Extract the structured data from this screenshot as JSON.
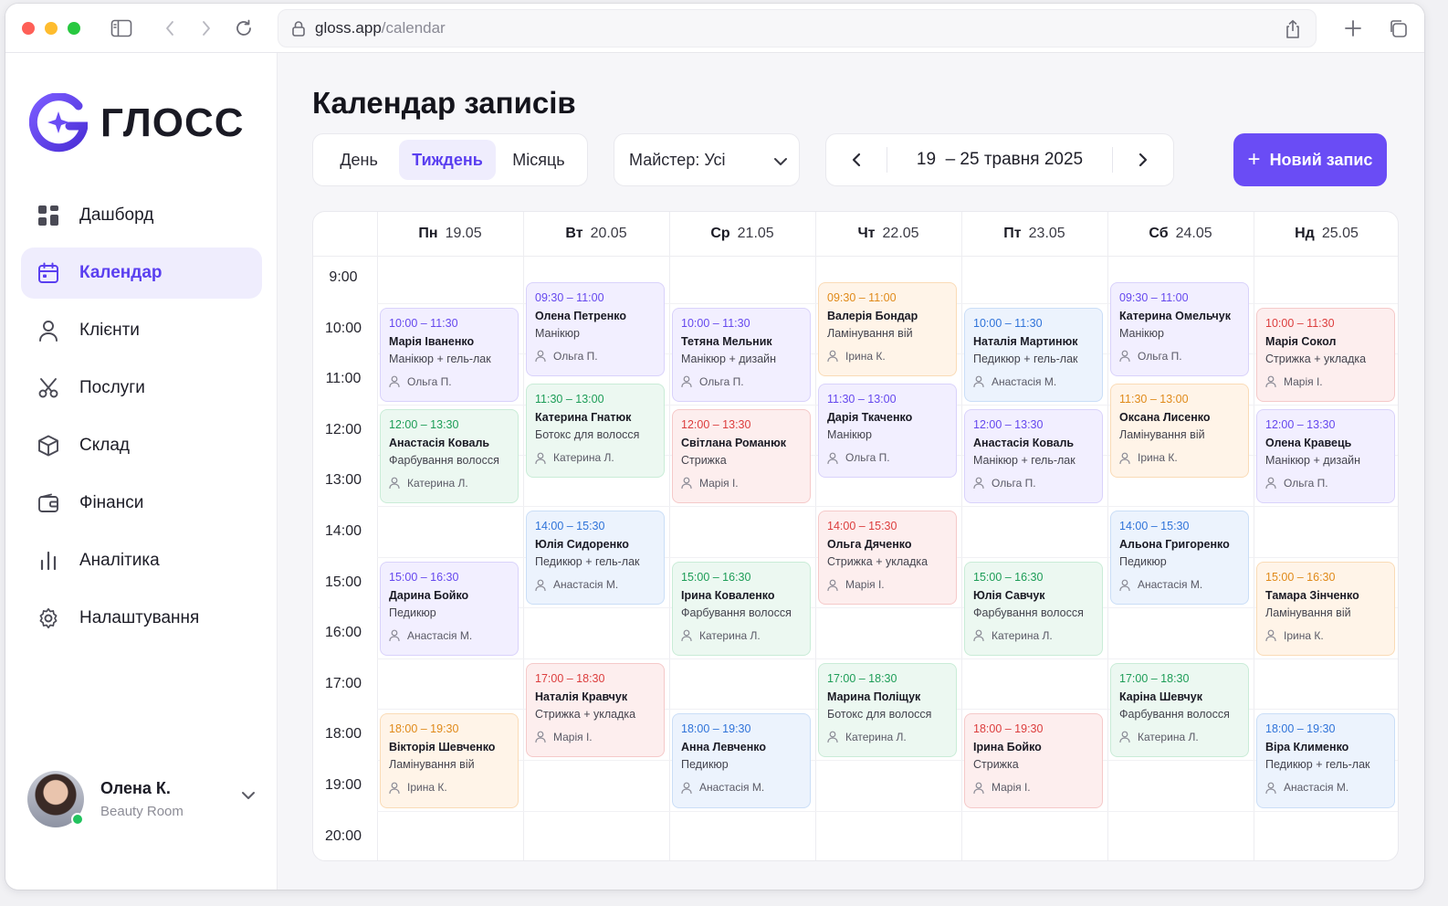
{
  "browser": {
    "url_host": "gloss.app",
    "url_path": "/calendar"
  },
  "brand": {
    "name": "ГЛОСС",
    "accent": "#6a4cf5"
  },
  "nav": [
    {
      "key": "dashboard",
      "label": "Дашборд",
      "icon": "grid-icon"
    },
    {
      "key": "calendar",
      "label": "Календар",
      "icon": "calendar-icon",
      "active": true
    },
    {
      "key": "clients",
      "label": "Клієнти",
      "icon": "user-icon"
    },
    {
      "key": "services",
      "label": "Послуги",
      "icon": "scissors-icon"
    },
    {
      "key": "stock",
      "label": "Склад",
      "icon": "box-icon"
    },
    {
      "key": "finance",
      "label": "Фінанси",
      "icon": "wallet-icon"
    },
    {
      "key": "analytics",
      "label": "Аналітика",
      "icon": "bar-chart-icon"
    },
    {
      "key": "settings",
      "label": "Налаштування",
      "icon": "gear-icon"
    }
  ],
  "user": {
    "name": "Олена К.",
    "subtitle": "Beauty Room"
  },
  "header": {
    "title": "Календар записів",
    "views": [
      {
        "label": "День"
      },
      {
        "label": "Тиждень",
        "active": true
      },
      {
        "label": "Місяць"
      }
    ],
    "master_filter": "Майстер: Усі",
    "date_range": "19  – 25 травня 2025",
    "new_button": "Новий запис"
  },
  "calendar": {
    "days": [
      {
        "dn": "Пн",
        "date": "19.05"
      },
      {
        "dn": "Вт",
        "date": "20.05"
      },
      {
        "dn": "Ср",
        "date": "21.05"
      },
      {
        "dn": "Чт",
        "date": "22.05"
      },
      {
        "dn": "Пт",
        "date": "23.05"
      },
      {
        "dn": "Сб",
        "date": "24.05"
      },
      {
        "dn": "Нд",
        "date": "25.05"
      }
    ],
    "hours": [
      "9:00",
      "10:00",
      "11:00",
      "12:00",
      "13:00",
      "14:00",
      "15:00",
      "16:00",
      "17:00",
      "18:00",
      "19:00",
      "20:00"
    ],
    "appointments": [
      {
        "day": 0,
        "start": 10.0,
        "time": "10:00 – 11:30",
        "client": "Марія Іваненко",
        "service": "Манікюр + гель-лак",
        "master": "Ольга П.",
        "color": "purple"
      },
      {
        "day": 0,
        "start": 12.0,
        "time": "12:00 – 13:30",
        "client": "Анастасія Коваль",
        "service": "Фарбування волосся",
        "master": "Катерина Л.",
        "color": "green"
      },
      {
        "day": 0,
        "start": 15.0,
        "time": "15:00 – 16:30",
        "client": "Дарина Бойко",
        "service": "Педикюр",
        "master": "Анастасія М.",
        "color": "purple"
      },
      {
        "day": 0,
        "start": 18.0,
        "time": "18:00 – 19:30",
        "client": "Вікторія Шевченко",
        "service": "Ламінування вій",
        "master": "Ірина К.",
        "color": "orange"
      },
      {
        "day": 1,
        "start": 9.5,
        "time": "09:30 – 11:00",
        "client": "Олена Петренко",
        "service": "Манікюр",
        "master": "Ольга П.",
        "color": "purple"
      },
      {
        "day": 1,
        "start": 11.5,
        "time": "11:30 – 13:00",
        "client": "Катерина Гнатюк",
        "service": "Ботокс для волосся",
        "master": "Катерина Л.",
        "color": "green"
      },
      {
        "day": 1,
        "start": 14.0,
        "time": "14:00 – 15:30",
        "client": "Юлія Сидоренко",
        "service": "Педикюр + гель-лак",
        "master": "Анастасія М.",
        "color": "blue"
      },
      {
        "day": 1,
        "start": 17.0,
        "time": "17:00 – 18:30",
        "client": "Наталія Кравчук",
        "service": "Стрижка + укладка",
        "master": "Марія І.",
        "color": "red"
      },
      {
        "day": 2,
        "start": 10.0,
        "time": "10:00 – 11:30",
        "client": "Тетяна Мельник",
        "service": "Манікюр + дизайн",
        "master": "Ольга П.",
        "color": "purple"
      },
      {
        "day": 2,
        "start": 12.0,
        "time": "12:00 – 13:30",
        "client": "Світлана Романюк",
        "service": "Стрижка",
        "master": "Марія І.",
        "color": "red"
      },
      {
        "day": 2,
        "start": 15.0,
        "time": "15:00 – 16:30",
        "client": "Ірина Коваленко",
        "service": "Фарбування волосся",
        "master": "Катерина Л.",
        "color": "green"
      },
      {
        "day": 2,
        "start": 18.0,
        "time": "18:00 – 19:30",
        "client": "Анна Левченко",
        "service": "Педикюр",
        "master": "Анастасія М.",
        "color": "blue"
      },
      {
        "day": 3,
        "start": 9.5,
        "time": "09:30 – 11:00",
        "client": "Валерія Бондар",
        "service": "Ламінування вій",
        "master": "Ірина К.",
        "color": "orange"
      },
      {
        "day": 3,
        "start": 11.5,
        "time": "11:30 – 13:00",
        "client": "Дарія Ткаченко",
        "service": "Манікюр",
        "master": "Ольга П.",
        "color": "purple"
      },
      {
        "day": 3,
        "start": 14.0,
        "time": "14:00 – 15:30",
        "client": "Ольга Дяченко",
        "service": "Стрижка + укладка",
        "master": "Марія І.",
        "color": "red"
      },
      {
        "day": 3,
        "start": 17.0,
        "time": "17:00 – 18:30",
        "client": "Марина Поліщук",
        "service": "Ботокс для волосся",
        "master": "Катерина Л.",
        "color": "green"
      },
      {
        "day": 4,
        "start": 10.0,
        "time": "10:00 – 11:30",
        "client": "Наталія Мартинюк",
        "service": "Педикюр + гель-лак",
        "master": "Анастасія М.",
        "color": "blue"
      },
      {
        "day": 4,
        "start": 12.0,
        "time": "12:00 – 13:30",
        "client": "Анастасія Коваль",
        "service": "Манікюр + гель-лак",
        "master": "Ольга П.",
        "color": "purple"
      },
      {
        "day": 4,
        "start": 15.0,
        "time": "15:00 – 16:30",
        "client": "Юлія Савчук",
        "service": "Фарбування волосся",
        "master": "Катерина Л.",
        "color": "green"
      },
      {
        "day": 4,
        "start": 18.0,
        "time": "18:00 – 19:30",
        "client": "Ірина Бойко",
        "service": "Стрижка",
        "master": "Марія І.",
        "color": "red"
      },
      {
        "day": 5,
        "start": 9.5,
        "time": "09:30 – 11:00",
        "client": "Катерина Омельчук",
        "service": "Манікюр",
        "master": "Ольга П.",
        "color": "purple"
      },
      {
        "day": 5,
        "start": 11.5,
        "time": "11:30 – 13:00",
        "client": "Оксана Лисенко",
        "service": "Ламінування вій",
        "master": "Ірина К.",
        "color": "orange"
      },
      {
        "day": 5,
        "start": 14.0,
        "time": "14:00 – 15:30",
        "client": "Альона Григоренко",
        "service": "Педикюр",
        "master": "Анастасія М.",
        "color": "blue"
      },
      {
        "day": 5,
        "start": 17.0,
        "time": "17:00 – 18:30",
        "client": "Каріна Шевчук",
        "service": "Фарбування волосся",
        "master": "Катерина Л.",
        "color": "green"
      },
      {
        "day": 6,
        "start": 10.0,
        "time": "10:00 – 11:30",
        "client": "Марія Сокол",
        "service": "Стрижка + укладка",
        "master": "Марія І.",
        "color": "red"
      },
      {
        "day": 6,
        "start": 12.0,
        "time": "12:00 – 13:30",
        "client": "Олена Кравець",
        "service": "Манікюр + дизайн",
        "master": "Ольга П.",
        "color": "purple"
      },
      {
        "day": 6,
        "start": 15.0,
        "time": "15:00 – 16:30",
        "client": "Тамара Зінченко",
        "service": "Ламінування вій",
        "master": "Ірина К.",
        "color": "orange"
      },
      {
        "day": 6,
        "start": 18.0,
        "time": "18:00 – 19:30",
        "client": "Віра Клименко",
        "service": "Педикюр + гель-лак",
        "master": "Анастасія М.",
        "color": "blue"
      }
    ]
  }
}
